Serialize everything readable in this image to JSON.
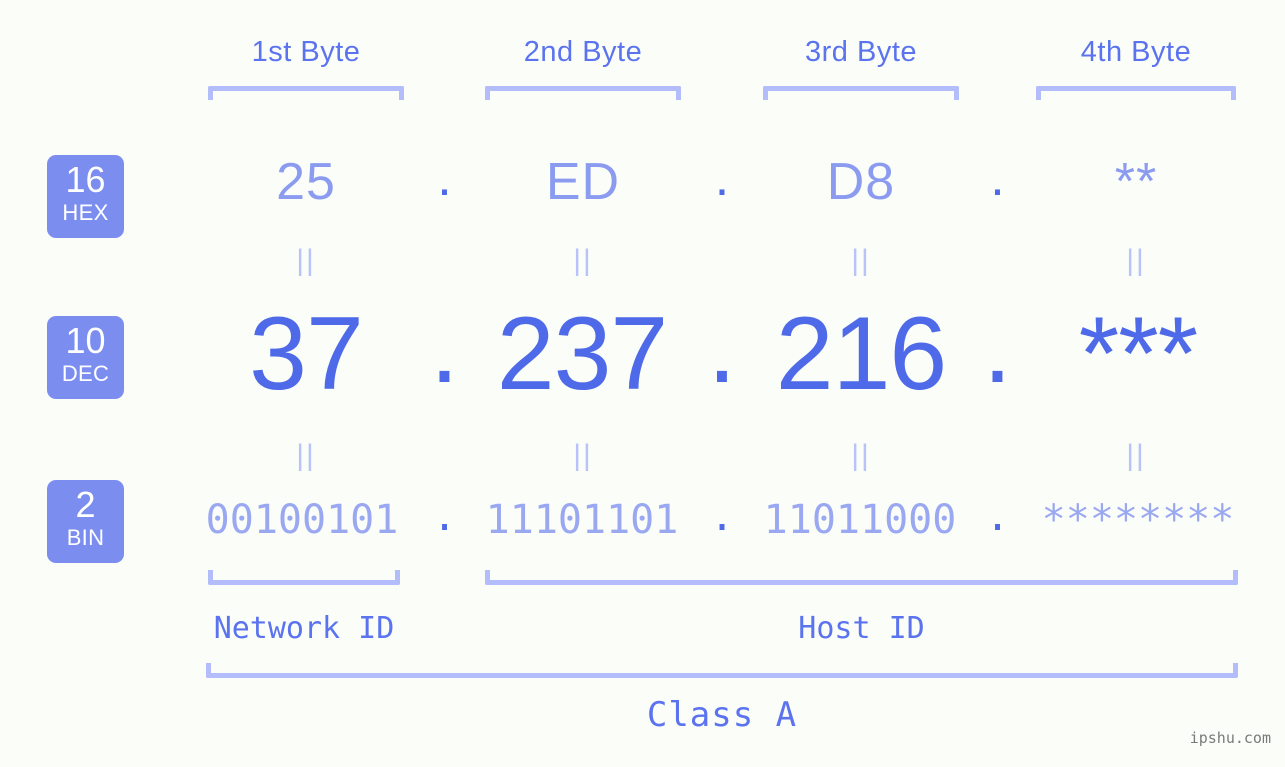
{
  "background": "#fbfdf9",
  "colors": {
    "badge_bg": "#7b8ef0",
    "badge_text": "#ffffff",
    "bracket": "#b3bdfb",
    "hex_text": "#8b9cf0",
    "dec_text": "#4e6ae8",
    "bin_text": "#9aa8f2",
    "label_text": "#5b73ee",
    "eq_text": "#b9c3f8",
    "watermark": "#7a7a7a"
  },
  "byte_headers": [
    {
      "label": "1st Byte"
    },
    {
      "label": "2nd Byte"
    },
    {
      "label": "3rd Byte"
    },
    {
      "label": "4th Byte"
    }
  ],
  "bases": [
    {
      "number": "16",
      "name": "HEX"
    },
    {
      "number": "10",
      "name": "DEC"
    },
    {
      "number": "2",
      "name": "BIN"
    }
  ],
  "rows": {
    "hex": {
      "base_number": "16",
      "base_name": "HEX",
      "values": [
        "25",
        "ED",
        "D8",
        "**"
      ],
      "separator": "."
    },
    "dec": {
      "base_number": "10",
      "base_name": "DEC",
      "values": [
        "37",
        "237",
        "216",
        "***"
      ],
      "separator": "."
    },
    "bin": {
      "base_number": "2",
      "base_name": "BIN",
      "values": [
        "00100101",
        "11101101",
        "11011000",
        "********"
      ],
      "separator": "."
    }
  },
  "equality_marks": {
    "symbol": "||",
    "count_per_row": 4
  },
  "segments": {
    "network_id": "Network ID",
    "host_id": "Host ID"
  },
  "class_label": "Class A",
  "watermark": "ipshu.com"
}
